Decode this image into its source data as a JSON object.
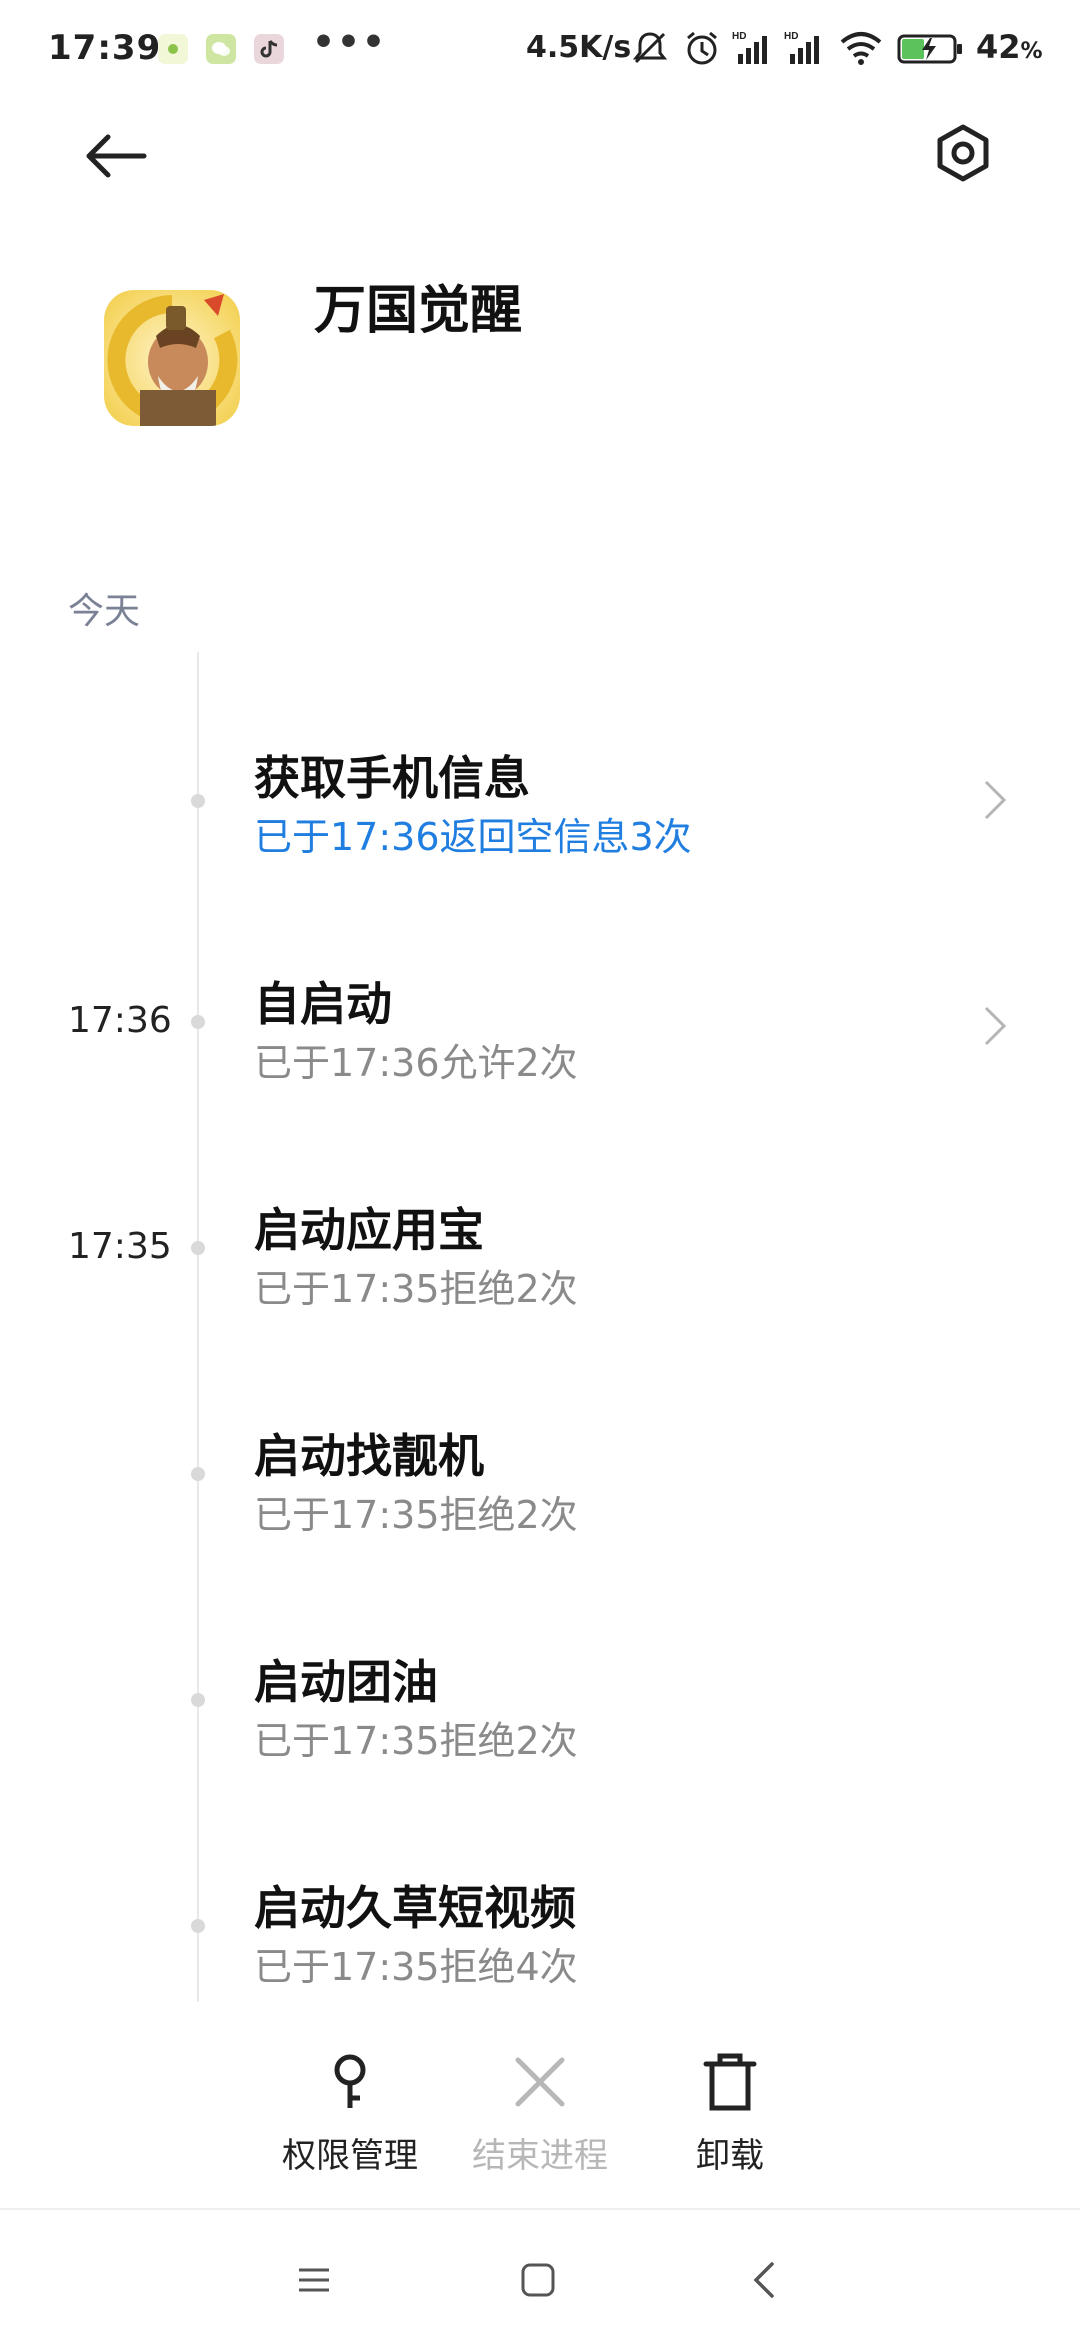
{
  "status_bar": {
    "time": "17:39",
    "overflow_dots": "•••",
    "net_speed": "4.5K/s",
    "battery_percent": "42",
    "battery_percent_sign": "%"
  },
  "header": {
    "back_icon": "arrow-left-icon",
    "settings_icon": "hexagon-settings-icon"
  },
  "app": {
    "name": "万国觉醒"
  },
  "section_label": "今天",
  "timeline": [
    {
      "time": "",
      "title": "获取手机信息",
      "subtitle": "已于17:36返回空信息3次",
      "subtitle_color": "#1f7ee0",
      "has_chevron": true
    },
    {
      "time": "17:36",
      "title": "自启动",
      "subtitle": "已于17:36允许2次",
      "subtitle_color": "#8a8a8a",
      "has_chevron": true
    },
    {
      "time": "17:35",
      "title": "启动应用宝",
      "subtitle": "已于17:35拒绝2次",
      "subtitle_color": "#8a8a8a",
      "has_chevron": false
    },
    {
      "time": "",
      "title": "启动找靓机",
      "subtitle": "已于17:35拒绝2次",
      "subtitle_color": "#8a8a8a",
      "has_chevron": false
    },
    {
      "time": "",
      "title": "启动团油",
      "subtitle": "已于17:35拒绝2次",
      "subtitle_color": "#8a8a8a",
      "has_chevron": false
    },
    {
      "time": "",
      "title": "启动久草短视频",
      "subtitle": "已于17:35拒绝4次",
      "subtitle_color": "#8a8a8a",
      "has_chevron": false
    }
  ],
  "actions": {
    "permissions": {
      "label": "权限管理",
      "icon": "key-icon"
    },
    "end_process": {
      "label": "结束进程",
      "icon": "close-icon",
      "disabled": true
    },
    "uninstall": {
      "label": "卸载",
      "icon": "trash-icon"
    }
  },
  "nav": {
    "menu_icon": "menu-icon",
    "home_icon": "home-square-icon",
    "back_icon": "back-chevron-icon"
  },
  "colors": {
    "accent_blue": "#1f7ee0",
    "muted_text": "#8a8a8a",
    "section_label": "#7b8296"
  }
}
